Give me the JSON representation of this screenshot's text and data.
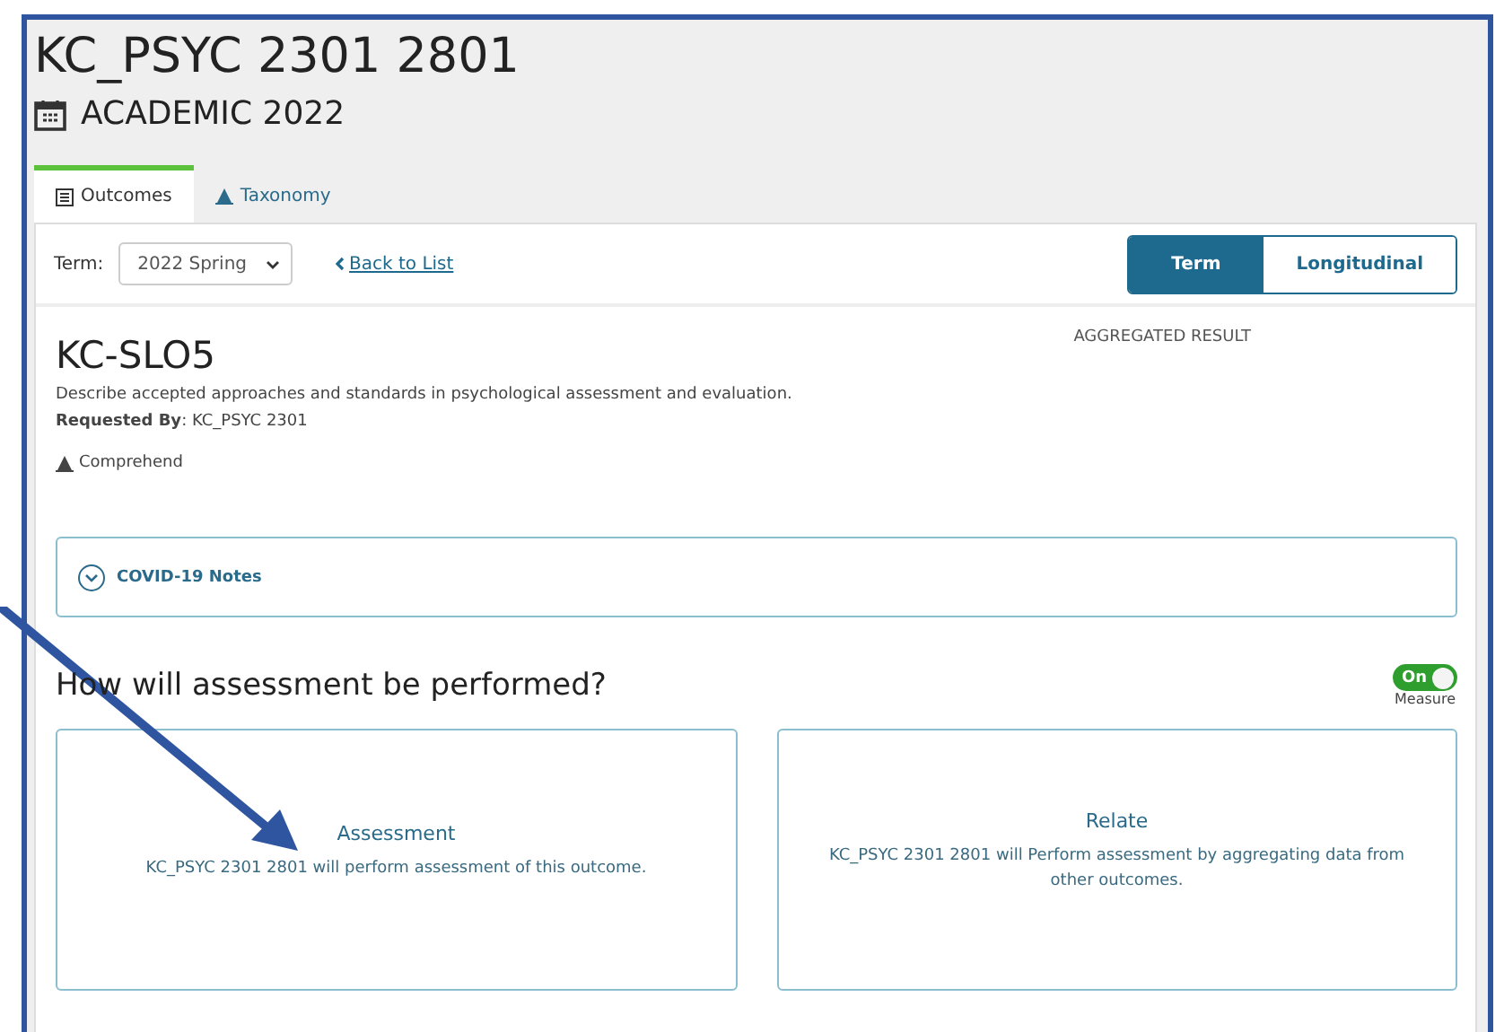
{
  "course": {
    "title": "KC_PSYC 2301 2801",
    "year": "ACADEMIC 2022"
  },
  "tabs": [
    {
      "label": "Outcomes",
      "kind": "list",
      "selected": true
    },
    {
      "label": "Taxonomy",
      "kind": "pyramid",
      "selected": false
    }
  ],
  "toolbar": {
    "term_label": "Term:",
    "term_value": "2022 Spring",
    "back_link": "Back to List",
    "views": [
      {
        "label": "Term",
        "selected": true
      },
      {
        "label": "Longitudinal",
        "selected": false
      }
    ]
  },
  "outcome": {
    "code": "KC-SLO5",
    "description": "Describe accepted approaches and standards in psychological assessment and evaluation.",
    "requested_by": "**Requested By**: KC_PSYC 2301",
    "taxonomy": "Comprehend",
    "aggregated_label": "AGGREGATED RESULT"
  },
  "notes": {
    "label": "COVID-19 Notes",
    "expanded": false
  },
  "assessment": {
    "heading": "How will assessment be performed?",
    "toggle_label": "On",
    "on": true,
    "toggle_caption": "Measure",
    "options": [
      {
        "title": "Assessment",
        "description": "KC_PSYC 2301 2801 will perform assessment of this outcome."
      },
      {
        "title": "Relate",
        "description": "KC_PSYC 2301 2801 will Perform assessment by aggregating data from other outcomes."
      }
    ]
  }
}
